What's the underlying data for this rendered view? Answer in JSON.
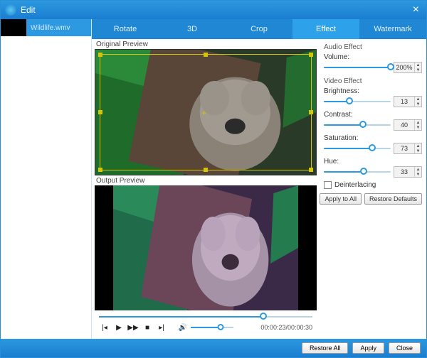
{
  "window": {
    "title": "Edit"
  },
  "sidebar": {
    "file_name": "Wildlife.wmv"
  },
  "tabs": [
    "Rotate",
    "3D",
    "Crop",
    "Effect",
    "Watermark"
  ],
  "active_tab_index": 3,
  "previews": {
    "original_label": "Original Preview",
    "output_label": "Output Preview"
  },
  "audio_effect": {
    "title": "Audio Effect",
    "volume": {
      "label": "Volume:",
      "value": "200%",
      "percent": 100
    }
  },
  "video_effect": {
    "title": "Video Effect",
    "brightness": {
      "label": "Brightness:",
      "value": "13",
      "percent": 38
    },
    "contrast": {
      "label": "Contrast:",
      "value": "40",
      "percent": 58
    },
    "saturation": {
      "label": "Saturation:",
      "value": "73",
      "percent": 72
    },
    "hue": {
      "label": "Hue:",
      "value": "33",
      "percent": 60
    },
    "deinterlacing": {
      "label": "Deinterlacing",
      "checked": false
    }
  },
  "effect_buttons": {
    "apply_all": "Apply to All",
    "restore_defaults": "Restore Defaults"
  },
  "transport": {
    "seek_percent": 77,
    "volume_percent": 70,
    "time": "00:00:23/00:00:30"
  },
  "footer": {
    "restore_all": "Restore All",
    "apply": "Apply",
    "close": "Close"
  }
}
